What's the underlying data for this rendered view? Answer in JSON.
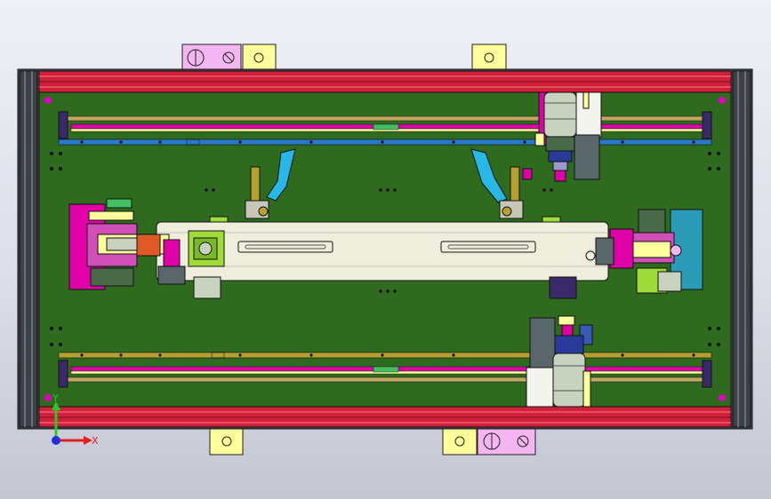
{
  "view": {
    "triad": {
      "x_label": "X",
      "y_label": "Y"
    }
  },
  "colors": {
    "plate": "#2f6b1f",
    "frame_red": "#d0203a",
    "rail_blue": "#2a78c8",
    "rail_gold": "#b8a030",
    "magenta": "#e000a8",
    "pad_yellow": "#ffff9c",
    "pad_pink": "#f3b6f0",
    "carriage": "#efeedd",
    "cylinder": "#c7d2bf",
    "gray_part": "#59676a",
    "lime": "#9fdc3a",
    "cyan_handle": "#28b8e8",
    "teal_block": "#2a9cb8"
  }
}
